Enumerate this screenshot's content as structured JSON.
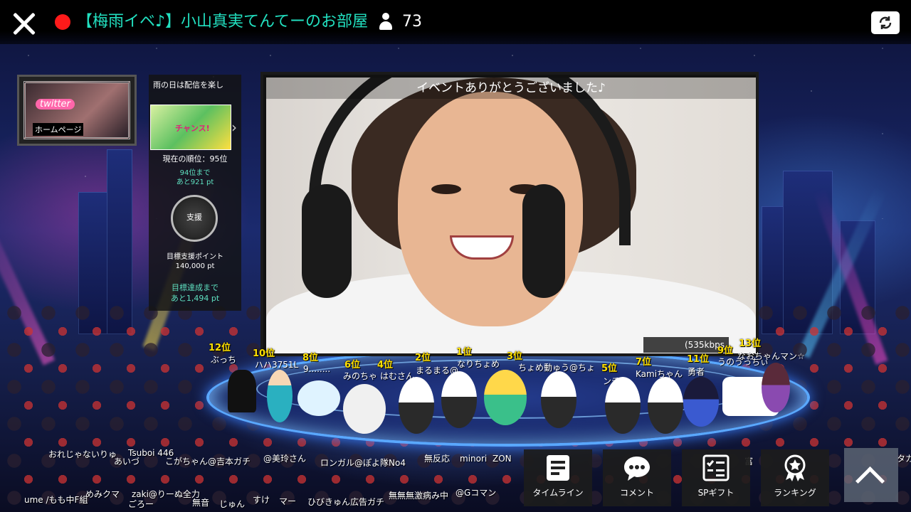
{
  "topbar": {
    "room_title": "【梅雨イベ♪】小山真実てんてーのお部屋",
    "viewer_count": "73"
  },
  "homepage": {
    "twitter_label": "twitter",
    "homepage_label": "ホームページ"
  },
  "event": {
    "name": "雨の日は配信を楽し",
    "banner_text": "チャンス!",
    "current_rank": "現在の順位：95位",
    "next_rank_line1": "94位まで",
    "next_rank_line2": "あと921 pt",
    "support_label": "支援",
    "goal_label_line1": "目標支援ポイント",
    "goal_label_line2": "140,000 pt",
    "goal_remain_line1": "目標達成まで",
    "goal_remain_line2": "あと1,494 pt"
  },
  "video": {
    "caption": "イベントありがとうございました♪",
    "bitrate": "(535kbps"
  },
  "rankings": [
    {
      "rank": "12位",
      "name": "ぶっち"
    },
    {
      "rank": "10位",
      "name": "ハハ3751L"
    },
    {
      "rank": "8位",
      "name": "9........"
    },
    {
      "rank": "6位",
      "name": "みのちゃ"
    },
    {
      "rank": "4位",
      "name": "はむさん"
    },
    {
      "rank": "2位",
      "name": "まるまる@"
    },
    {
      "rank": "1位",
      "name": "なりちょめ"
    },
    {
      "rank": "3位",
      "name": "ちょめ動"
    },
    {
      "rank": "5位",
      "name": "ゅう@ちょ"
    },
    {
      "rank": "7位",
      "name": "ンチャ"
    },
    {
      "rank": "9位",
      "name": "Kamiちゃん"
    },
    {
      "rank": "11位",
      "name": "勇者"
    },
    {
      "rank": "13位",
      "name": "なおちゃんマン☆"
    }
  ],
  "extra_names": [
    "うのうっちぃ",
    "おれじゃないりゅ",
    "Tsuboi 446",
    "こがちゃん@吉本ガチ",
    "@美玲さん",
    "ロンガル@ぽよ隊No4",
    "無反応",
    "minori",
    "ZON",
    "あいづ",
    "zaki@りーぬ全力",
    "ume /もも中F組",
    "ひびきゅん広告ガチ",
    "無無無激病み中",
    "@Gコマン",
    "めみクマ",
    "ごろー",
    "じゅん",
    "すけ",
    "マー",
    "無音",
    "富",
    "タカ"
  ],
  "bottom_buttons": {
    "timeline": "タイムライン",
    "comment": "コメント",
    "sp_gift": "SPギフト",
    "ranking": "ランキング"
  },
  "icons": [
    "close-icon",
    "live-indicator-icon",
    "viewer-icon",
    "camera-switch-icon",
    "timeline-icon",
    "comment-icon",
    "sp-gift-icon",
    "ranking-icon",
    "chevron-up-icon"
  ],
  "colors": {
    "title": "#22e0c0",
    "live": "#ff1a1a",
    "rank": "#ffe000",
    "accent": "#5fe0c0"
  }
}
